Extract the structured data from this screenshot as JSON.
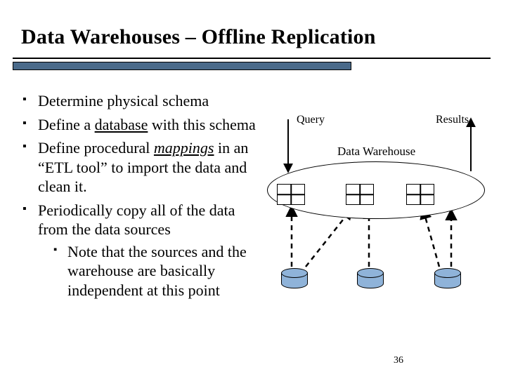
{
  "title": "Data Warehouses – Offline Replication",
  "bullets": [
    {
      "text_parts": [
        {
          "t": "Determine physical schema"
        }
      ]
    },
    {
      "text_parts": [
        {
          "t": "Define a "
        },
        {
          "t": "database",
          "cls": "underline"
        },
        {
          "t": " with this schema"
        }
      ]
    },
    {
      "text_parts": [
        {
          "t": "Define procedural "
        },
        {
          "t": "mappings",
          "cls": "italic underline"
        },
        {
          "t": " in an “ETL tool” to import the data and clean it."
        }
      ]
    },
    {
      "text_parts": [
        {
          "t": "Periodically copy all of the data from the data sources"
        }
      ],
      "sub": [
        {
          "text_parts": [
            {
              "t": "Note that the sources and the warehouse are basically independent at this point"
            }
          ]
        }
      ]
    }
  ],
  "diagram": {
    "query_label": "Query",
    "results_label": "Results",
    "dw_label": "Data Warehouse"
  },
  "page_number": "36"
}
